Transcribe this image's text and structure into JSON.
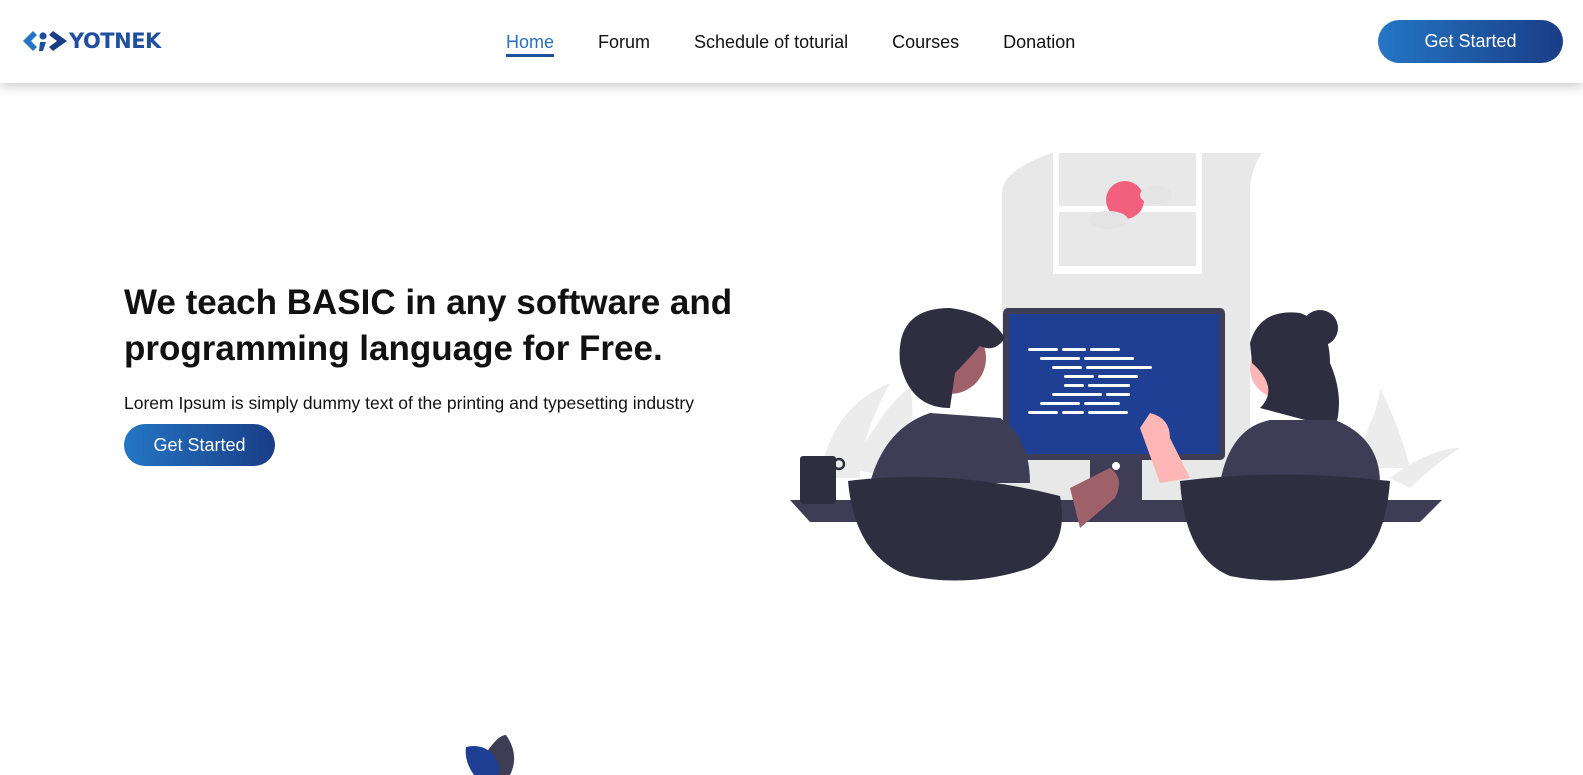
{
  "brand": {
    "name": "YOTNEK",
    "logo_icon": "code-brackets-icon"
  },
  "nav": {
    "items": [
      "Home",
      "Forum",
      "Schedule of toturial",
      "Courses",
      "Donation"
    ],
    "active": "Home"
  },
  "header": {
    "cta_label": "Get Started"
  },
  "hero": {
    "title": "We teach BASIC in any software and programming language for Free.",
    "subtitle": "Lorem Ipsum is simply dummy text of the printing and typesetting industry",
    "cta_label": "Get Started",
    "illustration": "two-people-coding-at-computer-illustration"
  },
  "colors": {
    "accent": "#1f4f9e",
    "accent_light": "#2476c4",
    "text": "#111111",
    "nav_active": "#2b6fbf"
  }
}
